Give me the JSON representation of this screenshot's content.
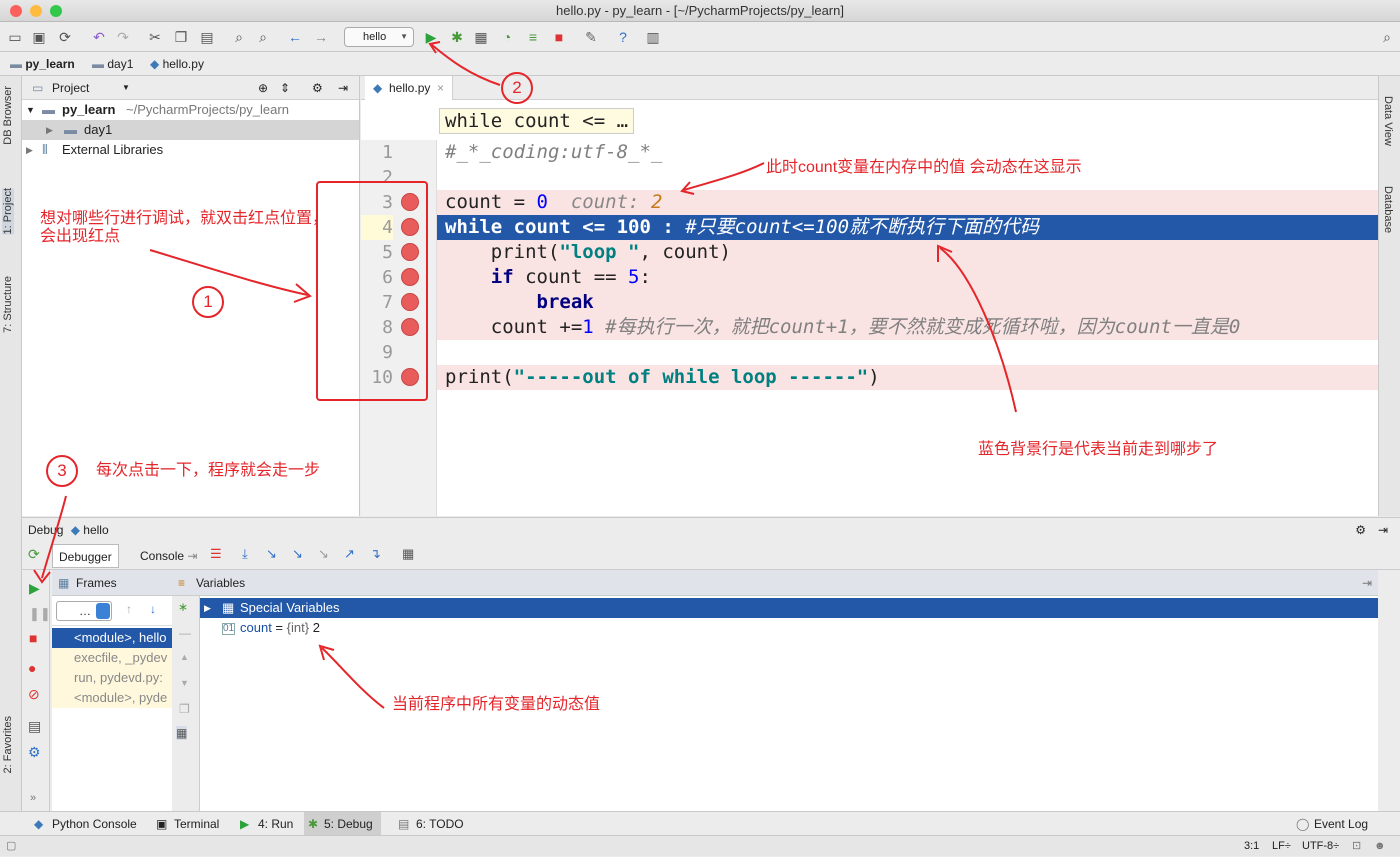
{
  "window": {
    "title": "hello.py - py_learn - [~/PycharmProjects/py_learn]"
  },
  "toolbar": {
    "run_config": "hello"
  },
  "breadcrumbs": [
    "py_learn",
    "day1",
    "hello.py"
  ],
  "left_tabs": [
    "DB Browser",
    "1: Project",
    "7: Structure",
    "2: Favorites"
  ],
  "right_tabs": [
    "Data View",
    "Database"
  ],
  "project": {
    "header": "Project",
    "root": {
      "name": "py_learn",
      "path": "~/PycharmProjects/py_learn"
    },
    "child": "day1",
    "external": "External Libraries"
  },
  "editor": {
    "tab": "hello.py",
    "context_hint": "while count <= …",
    "lines": [
      {
        "num": "1",
        "text": "#_*_coding:utf-8_*_"
      },
      {
        "num": "2",
        "text": ""
      },
      {
        "num": "3",
        "code": "count = ",
        "value": "0",
        "hint_label": "count: ",
        "hint_value": "2"
      },
      {
        "num": "4",
        "code": "while count <= 100 : ",
        "comment": "#只要count<=100就不断执行下面的代码"
      },
      {
        "num": "5",
        "code": "    print(",
        "str": "\"loop \"",
        "rest": ", count)"
      },
      {
        "num": "6",
        "kw": "    if",
        "rest": " count == ",
        "value": "5",
        "tail": ":"
      },
      {
        "num": "7",
        "kw": "        break"
      },
      {
        "num": "8",
        "code": "    count +=",
        "value": "1",
        "comment": " #每执行一次，就把count+1，要不然就变成死循环啦，因为count一直是0"
      },
      {
        "num": "9",
        "text": ""
      },
      {
        "num": "10",
        "code": "print(",
        "str": "\"-----out of while loop ------\"",
        "rest": ")"
      }
    ]
  },
  "debug": {
    "header_label": "Debug",
    "config": "hello",
    "tabs": {
      "debugger": "Debugger",
      "console": "Console"
    },
    "frames_header": "Frames",
    "variables_header": "Variables",
    "thread_select": "…",
    "frames": [
      "<module>, hello",
      "execfile, _pydev",
      "run, pydevd.py:",
      "<module>, pyde"
    ],
    "special_variables": "Special Variables",
    "variable": {
      "name": "count",
      "eq": " = ",
      "type": "{int}",
      "value": "2"
    }
  },
  "bottom_tools": [
    "Python Console",
    "Terminal",
    "4: Run",
    "5: Debug",
    "6: TODO"
  ],
  "event_log": "Event Log",
  "status": {
    "position": "3:1",
    "line_sep": "LF÷",
    "encoding": "UTF-8÷"
  },
  "annotations": {
    "a1": "想对哪些行进行调试，就双击红点位置，",
    "a1b": "会出现红点",
    "a2": "此时count变量在内存中的值 会动态在这显示",
    "a3": "蓝色背景行是代表当前走到哪步了",
    "a4": "每次点击一下，程序就会走一步",
    "a5": "当前程序中所有变量的动态值",
    "c1": "1",
    "c2": "2",
    "c3": "3"
  },
  "colors": {
    "current_line": "#2358a8",
    "breakpoint": "#e85c5c",
    "annotation": "#e4262b"
  }
}
